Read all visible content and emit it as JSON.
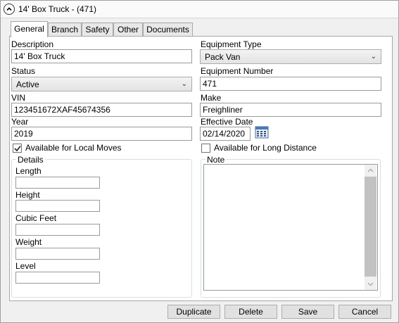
{
  "window": {
    "title": "14' Box Truck - (471)"
  },
  "tabs": [
    {
      "label": "General"
    },
    {
      "label": "Branch"
    },
    {
      "label": "Safety"
    },
    {
      "label": "Other"
    },
    {
      "label": "Documents"
    }
  ],
  "form": {
    "description": {
      "label": "Description",
      "value": "14' Box Truck"
    },
    "equipment_type": {
      "label": "Equipment Type",
      "value": "Pack Van"
    },
    "status": {
      "label": "Status",
      "value": "Active"
    },
    "equipment_number": {
      "label": "Equipment Number",
      "value": "471"
    },
    "vin": {
      "label": "VIN",
      "value": "123451672XAF45674356"
    },
    "make": {
      "label": "Make",
      "value": "Freighliner"
    },
    "year": {
      "label": "Year",
      "value": "2019"
    },
    "effective_date": {
      "label": "Effective Date",
      "value": "02/14/2020"
    },
    "local_moves": {
      "label": "Available for Local Moves",
      "checked": true
    },
    "long_distance": {
      "label": "Available for Long Distance",
      "checked": false
    }
  },
  "details": {
    "title": "Details",
    "fields": {
      "length": {
        "label": "Length",
        "value": ""
      },
      "height": {
        "label": "Height",
        "value": ""
      },
      "cubic_feet": {
        "label": "Cubic Feet",
        "value": ""
      },
      "weight": {
        "label": "Weight",
        "value": ""
      },
      "level": {
        "label": "Level",
        "value": ""
      }
    }
  },
  "note": {
    "title": "Note",
    "value": ""
  },
  "buttons": {
    "duplicate": "Duplicate",
    "delete": "Delete",
    "save": "Save",
    "cancel": "Cancel"
  },
  "icons": {
    "collapse": "chevron-up-icon",
    "calendar": "calendar-icon",
    "check": "checkmark-icon"
  }
}
